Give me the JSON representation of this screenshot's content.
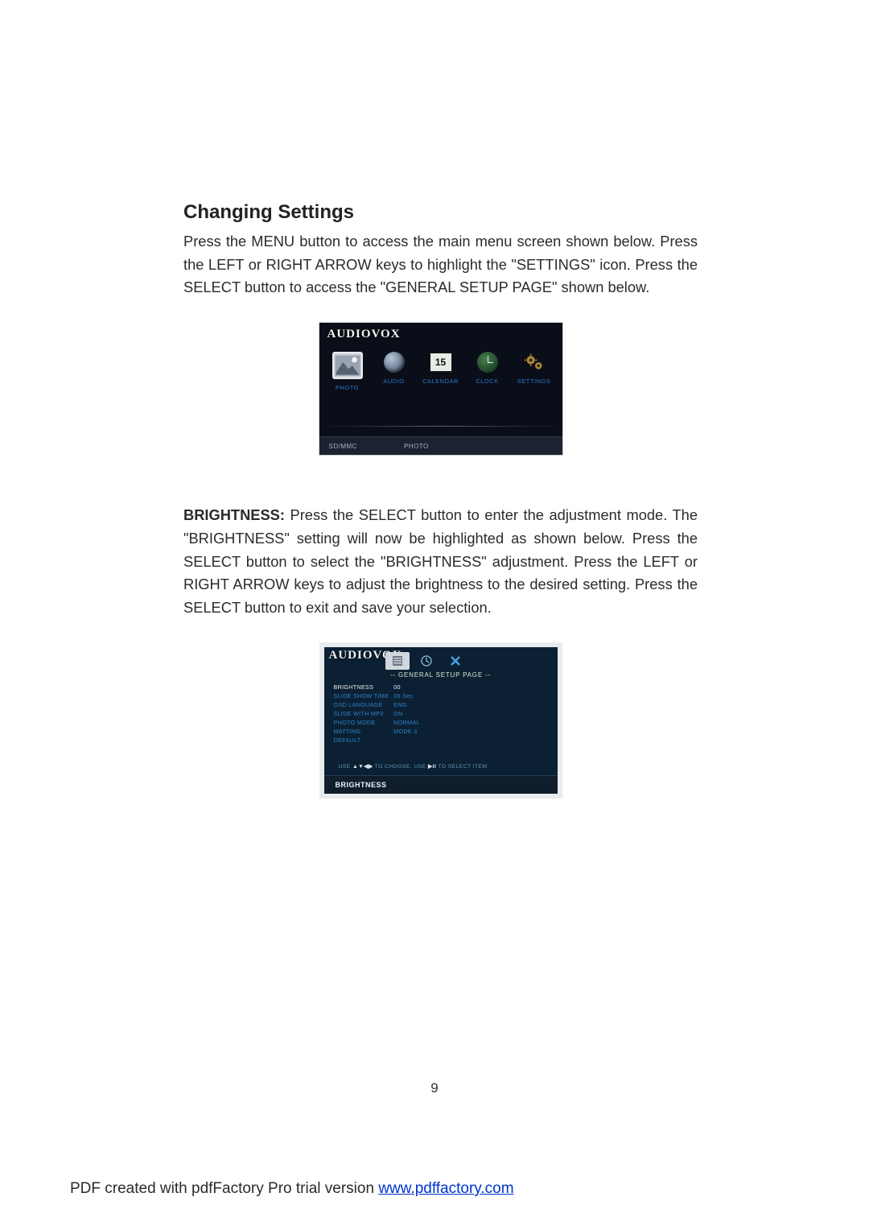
{
  "heading": "Changing Settings",
  "intro_text": "Press the MENU button to access the main menu screen shown below.  Press the LEFT or RIGHT ARROW keys to highlight the \"SETTINGS\" icon.  Press the SELECT button to access the \"GENERAL SETUP PAGE\" shown below.",
  "brand": "AUDIOVOX",
  "main_menu": {
    "icons": [
      {
        "label": "PHOTO"
      },
      {
        "label": "AUDIO"
      },
      {
        "label": "CALENDAR",
        "day": "15"
      },
      {
        "label": "CLOCK"
      },
      {
        "label": "SETTINGS"
      }
    ],
    "bottom_left": "SD/MMC",
    "bottom_right": "PHOTO"
  },
  "brightness_label": "BRIGHTNESS:",
  "brightness_text": " Press the SELECT button to enter the adjustment mode. The \"BRIGHTNESS\" setting will now be highlighted as shown below. Press the SELECT button to select the \"BRIGHTNESS\" adjustment.  Press the LEFT or RIGHT ARROW keys to adjust the brightness to the desired setting.  Press the SELECT button to exit and save your selection.",
  "setup_page": {
    "title": "--   GENERAL SETUP PAGE   --",
    "rows": [
      {
        "k": "BRIGHTNESS",
        "v": "00",
        "sel": true
      },
      {
        "k": "SLIDE SHOW TIME",
        "v": "05 Sec",
        "sel": false
      },
      {
        "k": "OSD LANGUAGE",
        "v": "ENG",
        "sel": false
      },
      {
        "k": "SLIDE  WITH  MP3",
        "v": "ON",
        "sel": false
      },
      {
        "k": "PHOTO  MODE",
        "v": "NORMAL",
        "sel": false
      },
      {
        "k": "MATTING",
        "v": "MODE  3",
        "sel": false
      },
      {
        "k": "DEFAULT",
        "v": "",
        "sel": false
      }
    ],
    "hint_prefix": "USE  ",
    "hint_arrows": "▲▼◀▶",
    "hint_mid": " TO CHOOSE,  USE ",
    "hint_btn": "▶II",
    "hint_suffix": " TO  SELECT ITEM",
    "footer": "BRIGHTNESS"
  },
  "page_number": "9",
  "pdf_footer_prefix": "PDF created with pdfFactory Pro trial version ",
  "pdf_footer_link": "www.pdffactory.com"
}
